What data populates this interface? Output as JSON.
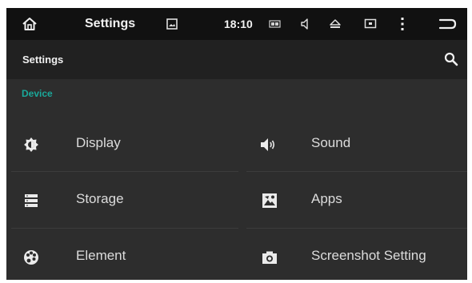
{
  "status_bar": {
    "title": "Settings",
    "time": "18:10",
    "icons": [
      "home-icon",
      "gallery-icon",
      "battery-icon",
      "volume-icon",
      "eject-icon",
      "screen-icon",
      "more-vert-icon",
      "back-icon"
    ]
  },
  "action_bar": {
    "title": "Settings",
    "search_icon": "search-icon"
  },
  "section": {
    "label": "Device"
  },
  "items": [
    {
      "label": "Display",
      "icon": "brightness-icon"
    },
    {
      "label": "Sound",
      "icon": "speaker-icon"
    },
    {
      "label": "Storage",
      "icon": "storage-icon"
    },
    {
      "label": "Apps",
      "icon": "apps-icon"
    },
    {
      "label": "Element",
      "icon": "palette-icon"
    },
    {
      "label": "Screenshot Setting",
      "icon": "camera-icon"
    }
  ],
  "colors": {
    "accent": "#1aa89a",
    "background": "#2d2d2d",
    "status_bar": "#111111",
    "action_bar": "#212121"
  }
}
